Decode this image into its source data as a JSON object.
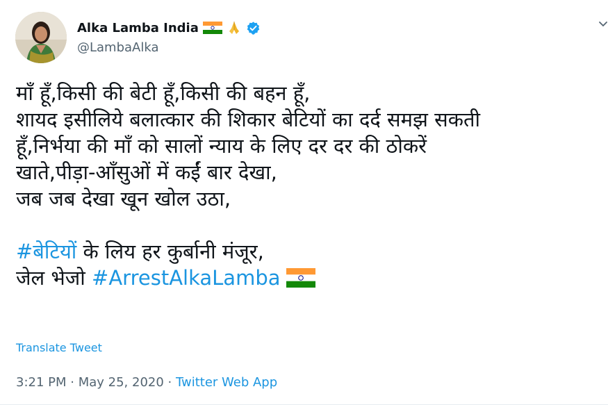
{
  "user": {
    "display_name": "Alka Lamba India",
    "handle": "@LambaAlka",
    "verified": true,
    "name_emoji_icons": [
      "india-flag-icon",
      "folded-hands-icon"
    ]
  },
  "tweet": {
    "lines": [
      "माँ हूँ,किसी की बेटी हूँ,किसी की बहन हूँ,",
      "शायद इसीलिये बलात्कार की शिकार बेटियों का दर्द समझ सकती",
      "हूँ,निर्भया की माँ को सालों न्याय के लिए दर दर की ठोकरें",
      "खाते,पीड़ा-आँसुओं में कईं बार देखा,",
      "जब जब देखा खून खोल उठा,"
    ],
    "line6_hashtag": "#बेटियों",
    "line6_rest": " के लिय हर कुर्बानी मंजूर,",
    "line7_text": "जेल भेजो ",
    "line7_hashtag": "#ArrestAlkaLamba"
  },
  "translate_label": "Translate Tweet",
  "meta": {
    "time": "3:21 PM",
    "separator1": " · ",
    "date": "May 25, 2020",
    "separator2": " · ",
    "source": "Twitter Web App"
  },
  "colors": {
    "link": "#1b95e0",
    "secondary": "#536471",
    "verified": "#1da1f2",
    "saffron": "#ff9933",
    "green": "#138808",
    "chakra": "#000080"
  }
}
